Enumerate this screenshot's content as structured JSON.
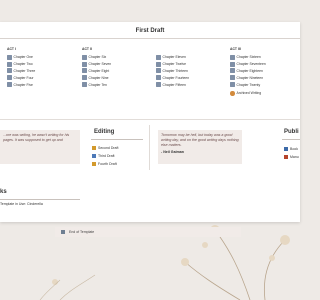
{
  "page": {
    "title": "First Draft"
  },
  "acts": [
    {
      "label": "ACT I",
      "chapters": [
        "Chapter One",
        "Chapter Two",
        "Chapter Three",
        "Chapter Four",
        "Chapter Five"
      ]
    },
    {
      "label": "ACT II",
      "chapters": [
        "Chapter Six",
        "Chapter Seven",
        "Chapter Eight",
        "Chapter Nine",
        "Chapter Ten"
      ]
    },
    {
      "label": "",
      "chapters": [
        "Chapter Eleven",
        "Chapter Twelve",
        "Chapter Thirteen",
        "Chapter Fourteen",
        "Chapter Fifteen"
      ]
    },
    {
      "label": "ACT III",
      "chapters": [
        "Chapter Sixteen",
        "Chapter Seventeen",
        "Chapter Eighteen",
        "Chapter Nineteen",
        "Chapter Twenty"
      ]
    }
  ],
  "archived": "Archived Writing",
  "quote_left": "...ore was writing, he wasn't writing for his pages. It was supposed to get up and",
  "quote_right": "Tomorrow may be hell, but today was a good writing day, and on the good writing days nothing else matters.",
  "quote_right_author": "- Neil Gaiman",
  "editing": {
    "heading": "Editing",
    "items": [
      "Second Draft",
      "Third Draft",
      "Fourth Draft"
    ],
    "colors": [
      "#d39a2c",
      "#4d79b8",
      "#d39a2c"
    ]
  },
  "publishing": {
    "heading": "Publi",
    "items": [
      "Book",
      "Manu"
    ]
  },
  "left_section": {
    "heading": "ks",
    "note": "Template in Use: Cinderella"
  },
  "end_label": "End of Template"
}
